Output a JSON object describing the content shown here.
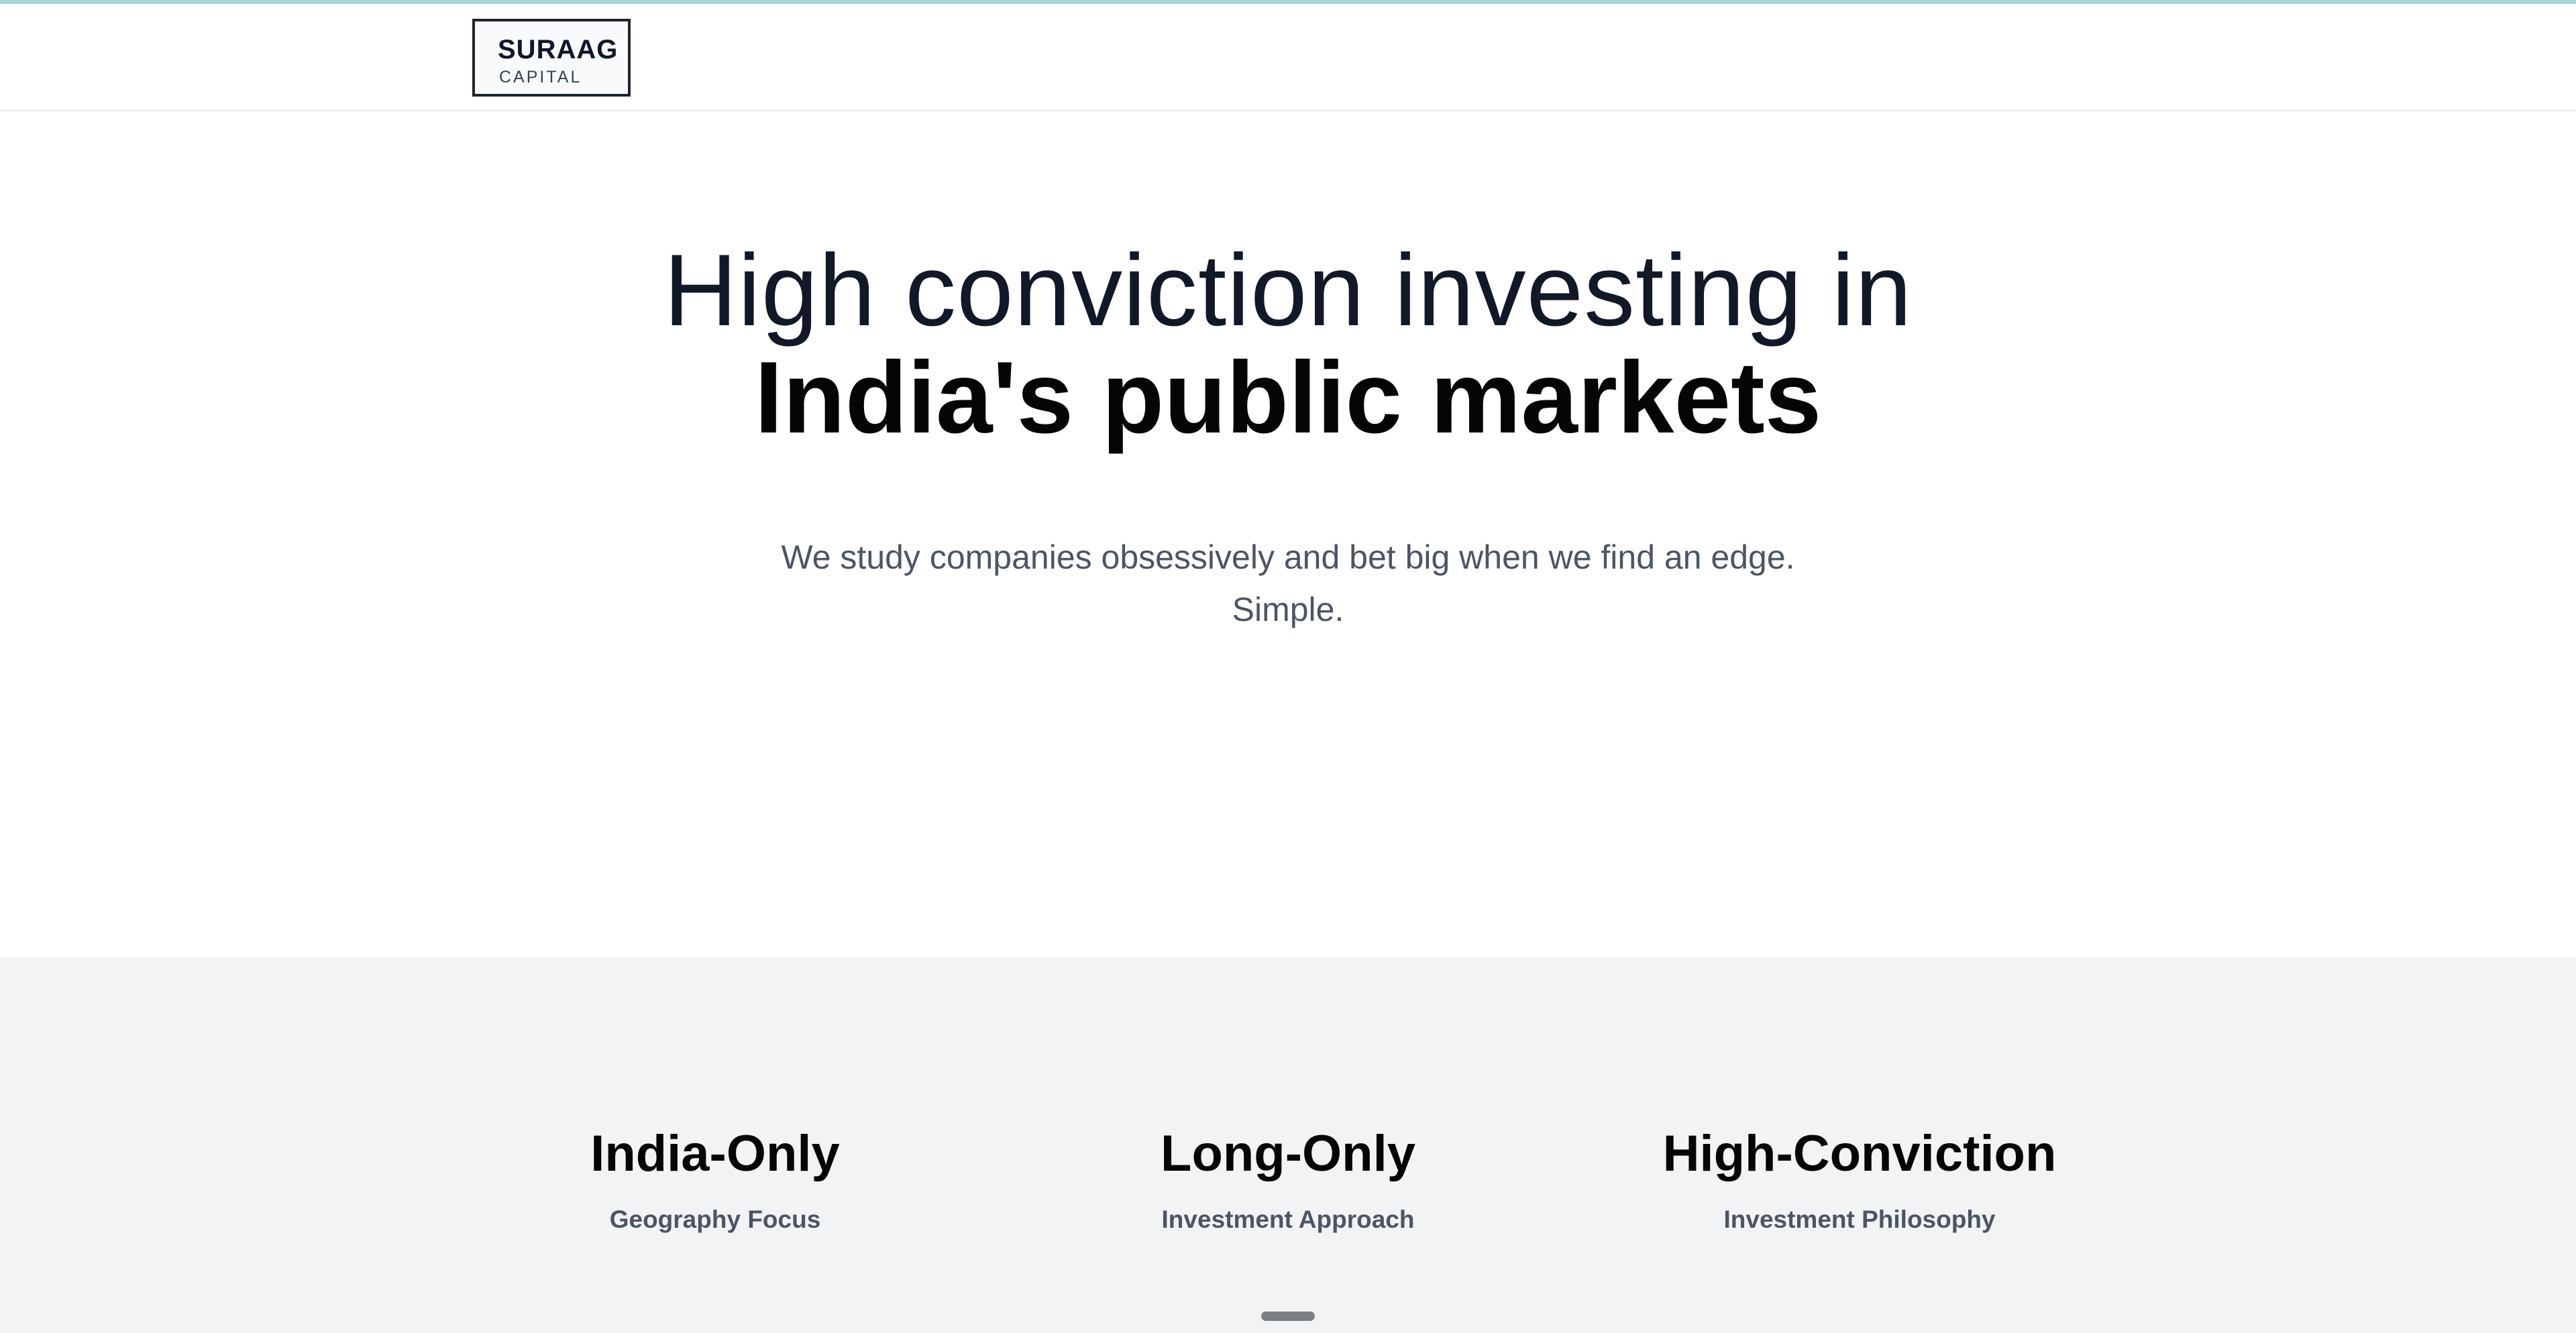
{
  "header": {
    "logo": {
      "name": "SURAAG",
      "subtitle": "CAPITAL"
    }
  },
  "hero": {
    "title_line1": "High conviction investing in",
    "title_line2": "India's public markets",
    "subtitle_line1": "We study companies obsessively and bet big when we find an edge.",
    "subtitle_line2": "Simple."
  },
  "features": [
    {
      "title": "India-Only",
      "label": "Geography Focus"
    },
    {
      "title": "Long-Only",
      "label": "Investment Approach"
    },
    {
      "title": "High-Conviction",
      "label": "Investment Philosophy"
    }
  ],
  "colors": {
    "top_accent": "#a9d6d8",
    "heading_text": "#111827",
    "body_text": "#4b5563",
    "section_bg": "#f2f3f5"
  }
}
